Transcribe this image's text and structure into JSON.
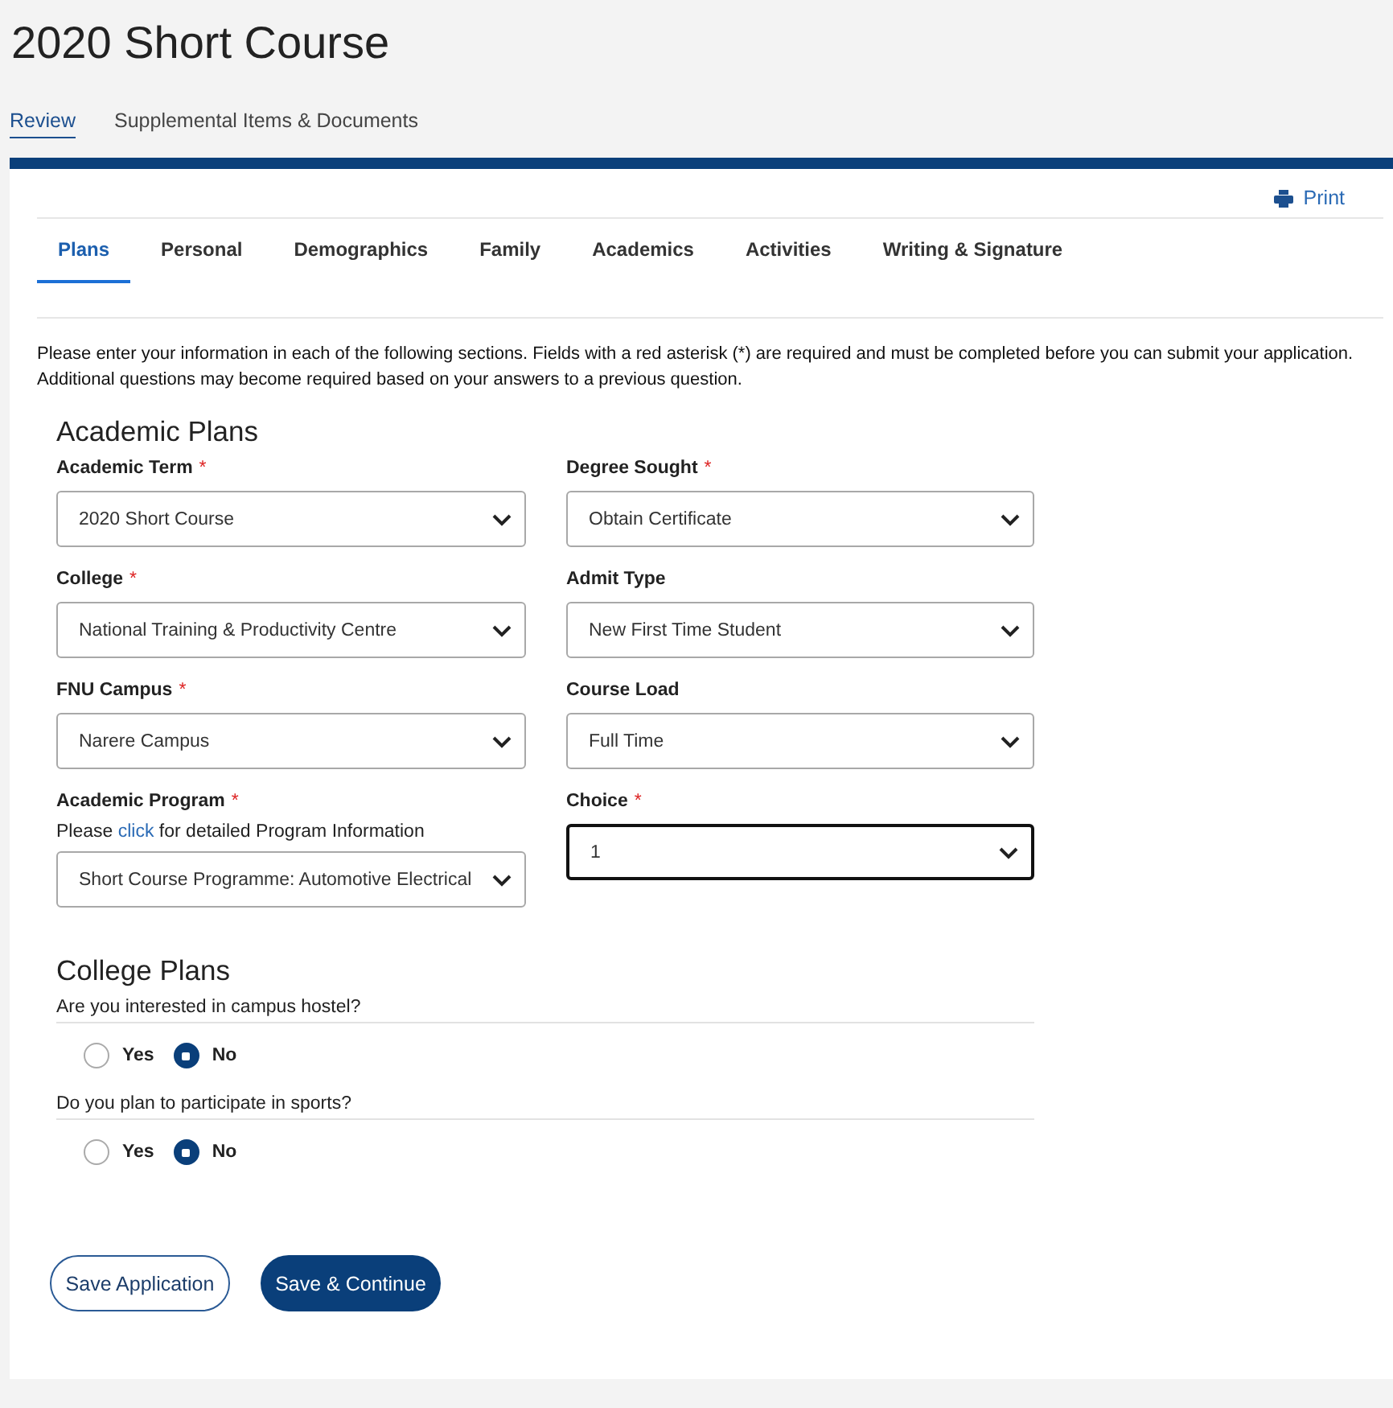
{
  "page_title": "2020 Short Course",
  "page_tabs": [
    {
      "label": "Review",
      "selected": true
    },
    {
      "label": "Supplemental Items & Documents",
      "selected": false
    }
  ],
  "print_link": "Print",
  "section_tabs": [
    {
      "label": "Plans",
      "selected": true
    },
    {
      "label": "Personal",
      "selected": false
    },
    {
      "label": "Demographics",
      "selected": false
    },
    {
      "label": "Family",
      "selected": false
    },
    {
      "label": "Academics",
      "selected": false
    },
    {
      "label": "Activities",
      "selected": false
    },
    {
      "label": "Writing & Signature",
      "selected": false
    }
  ],
  "intro": "Please enter your information in each of the following sections. Fields with a red asterisk (*) are required and must be completed before you can submit your application. Additional questions may become required based on your answers to a previous question.",
  "academic_plans": {
    "heading": "Academic Plans",
    "fields": [
      {
        "label": "Academic Term",
        "required_mark": "*",
        "value": "2020 Short Course",
        "focused": false
      },
      {
        "label": "Degree Sought",
        "required_mark": "*",
        "value": "Obtain Certificate",
        "focused": false
      },
      {
        "label": "College",
        "required_mark": "*",
        "value": "National Training & Productivity Centre",
        "focused": false
      },
      {
        "label": "Admit Type",
        "value": "New First Time Student",
        "focused": false
      },
      {
        "label": "FNU Campus",
        "required_mark": "*",
        "value": "Narere Campus",
        "focused": false
      },
      {
        "label": "Course Load",
        "value": "Full Time",
        "focused": false
      },
      {
        "label": "Academic Program",
        "required_mark": "*",
        "help": {
          "before": "Please ",
          "link": "click",
          "after": " for detailed Program Information"
        },
        "value": "Short Course Programme: Automotive Electrical",
        "focused": false
      },
      {
        "label": "Choice",
        "required_mark": "*",
        "value": "1",
        "focused": true
      }
    ]
  },
  "college_plans": {
    "heading": "College Plans",
    "questions": [
      {
        "question": "Are you interested in campus hostel?",
        "options": [
          {
            "label": "Yes",
            "selected": false
          },
          {
            "label": "No",
            "selected": true
          }
        ]
      },
      {
        "question": "Do you plan to participate in sports?",
        "options": [
          {
            "label": "Yes",
            "selected": false
          },
          {
            "label": "No",
            "selected": true
          }
        ]
      }
    ]
  },
  "buttons": [
    {
      "label": "Save Application",
      "kind": "secondary"
    },
    {
      "label": "Save & Continue",
      "kind": "primary"
    }
  ]
}
